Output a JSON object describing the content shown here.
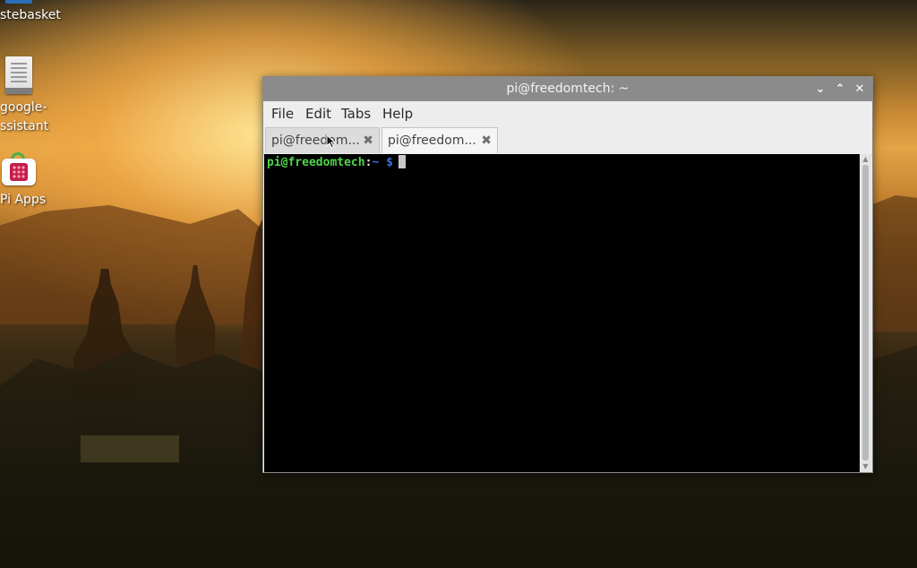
{
  "desktop": {
    "icons": [
      {
        "label": "stebasket",
        "icon": "wastebasket-icon"
      },
      {
        "label_line1": "google-",
        "label_line2": "ssistant",
        "icon": "document-icon"
      },
      {
        "label": "Pi Apps",
        "icon": "pi-apps-icon"
      }
    ]
  },
  "window": {
    "title": "pi@freedomtech: ~",
    "controls": {
      "minimize": "⌄",
      "maximize": "⌃",
      "close": "✕"
    }
  },
  "menu": {
    "file": "File",
    "edit": "Edit",
    "tabs": "Tabs",
    "help": "Help"
  },
  "tabs": [
    {
      "label": "pi@freedom...",
      "close": "✖",
      "active": false
    },
    {
      "label": "pi@freedom...",
      "close": "✖",
      "active": true
    }
  ],
  "console": {
    "user_host": "pi@freedomtech",
    "colon": ":",
    "path": "~",
    "dollar": "$"
  },
  "scrollbar": {
    "up_arrow": "▲",
    "down_arrow": "▼"
  },
  "colors": {
    "prompt_user": "#4fd64a",
    "prompt_path": "#3b6fe0",
    "titlebar": "#8b8b8b",
    "console_bg": "#000000"
  }
}
